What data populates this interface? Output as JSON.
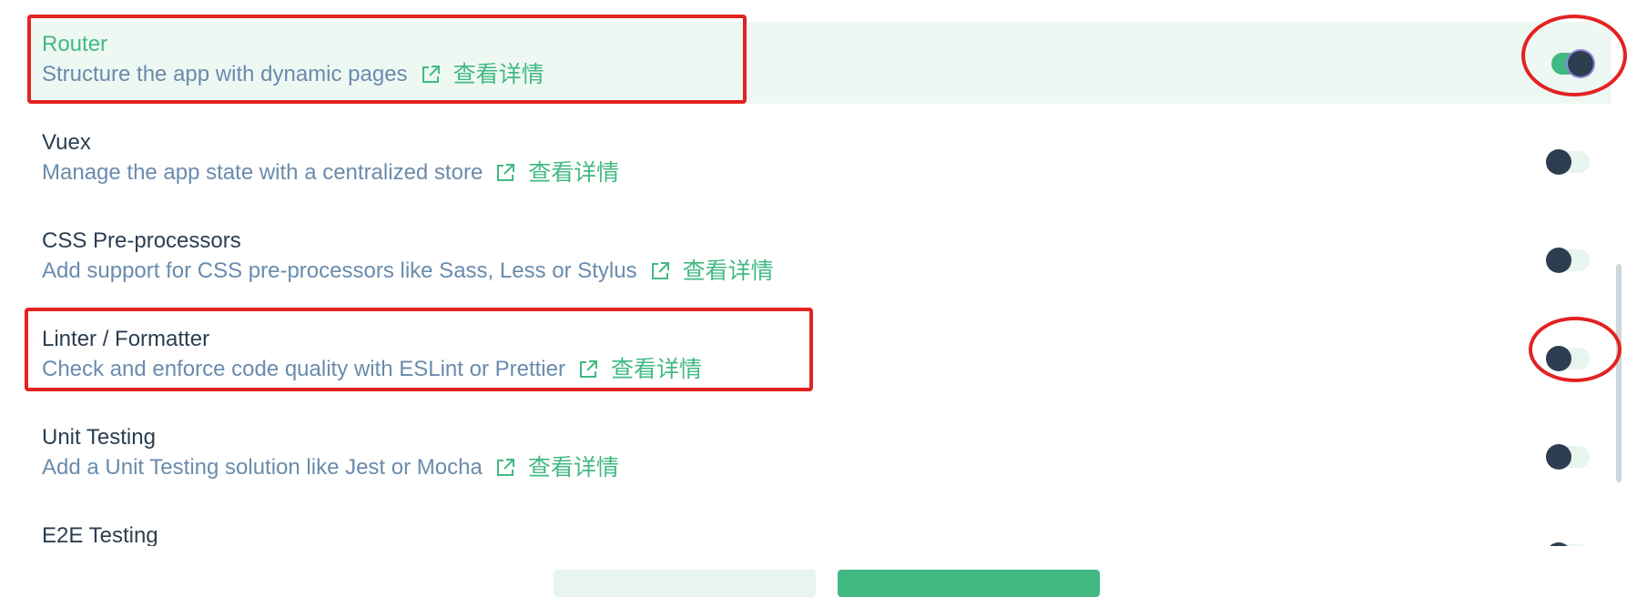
{
  "link_text": "查看详情",
  "colors": {
    "accent": "#42b983",
    "text": "#2c3e50",
    "description": "#6a8bad",
    "selected_bg": "#eef8f3",
    "annotation": "#e32222"
  },
  "features": [
    {
      "title": "Router",
      "description": "Structure the app with dynamic pages",
      "enabled": true,
      "link_icon": "external-link-icon"
    },
    {
      "title": "Vuex",
      "description": "Manage the app state with a centralized store",
      "enabled": false,
      "link_icon": "external-link-icon"
    },
    {
      "title": "CSS Pre-processors",
      "description": "Add support for CSS pre-processors like Sass, Less or Stylus",
      "enabled": false,
      "link_icon": "external-link-icon"
    },
    {
      "title": "Linter / Formatter",
      "description": "Check and enforce code quality with ESLint or Prettier",
      "enabled": false,
      "link_icon": "external-link-icon"
    },
    {
      "title": "Unit Testing",
      "description": "Add a Unit Testing solution like Jest or Mocha",
      "enabled": false,
      "link_icon": "external-link-icon"
    },
    {
      "title": "E2E Testing",
      "description": "",
      "enabled": false,
      "link_icon": "external-link-icon"
    }
  ]
}
